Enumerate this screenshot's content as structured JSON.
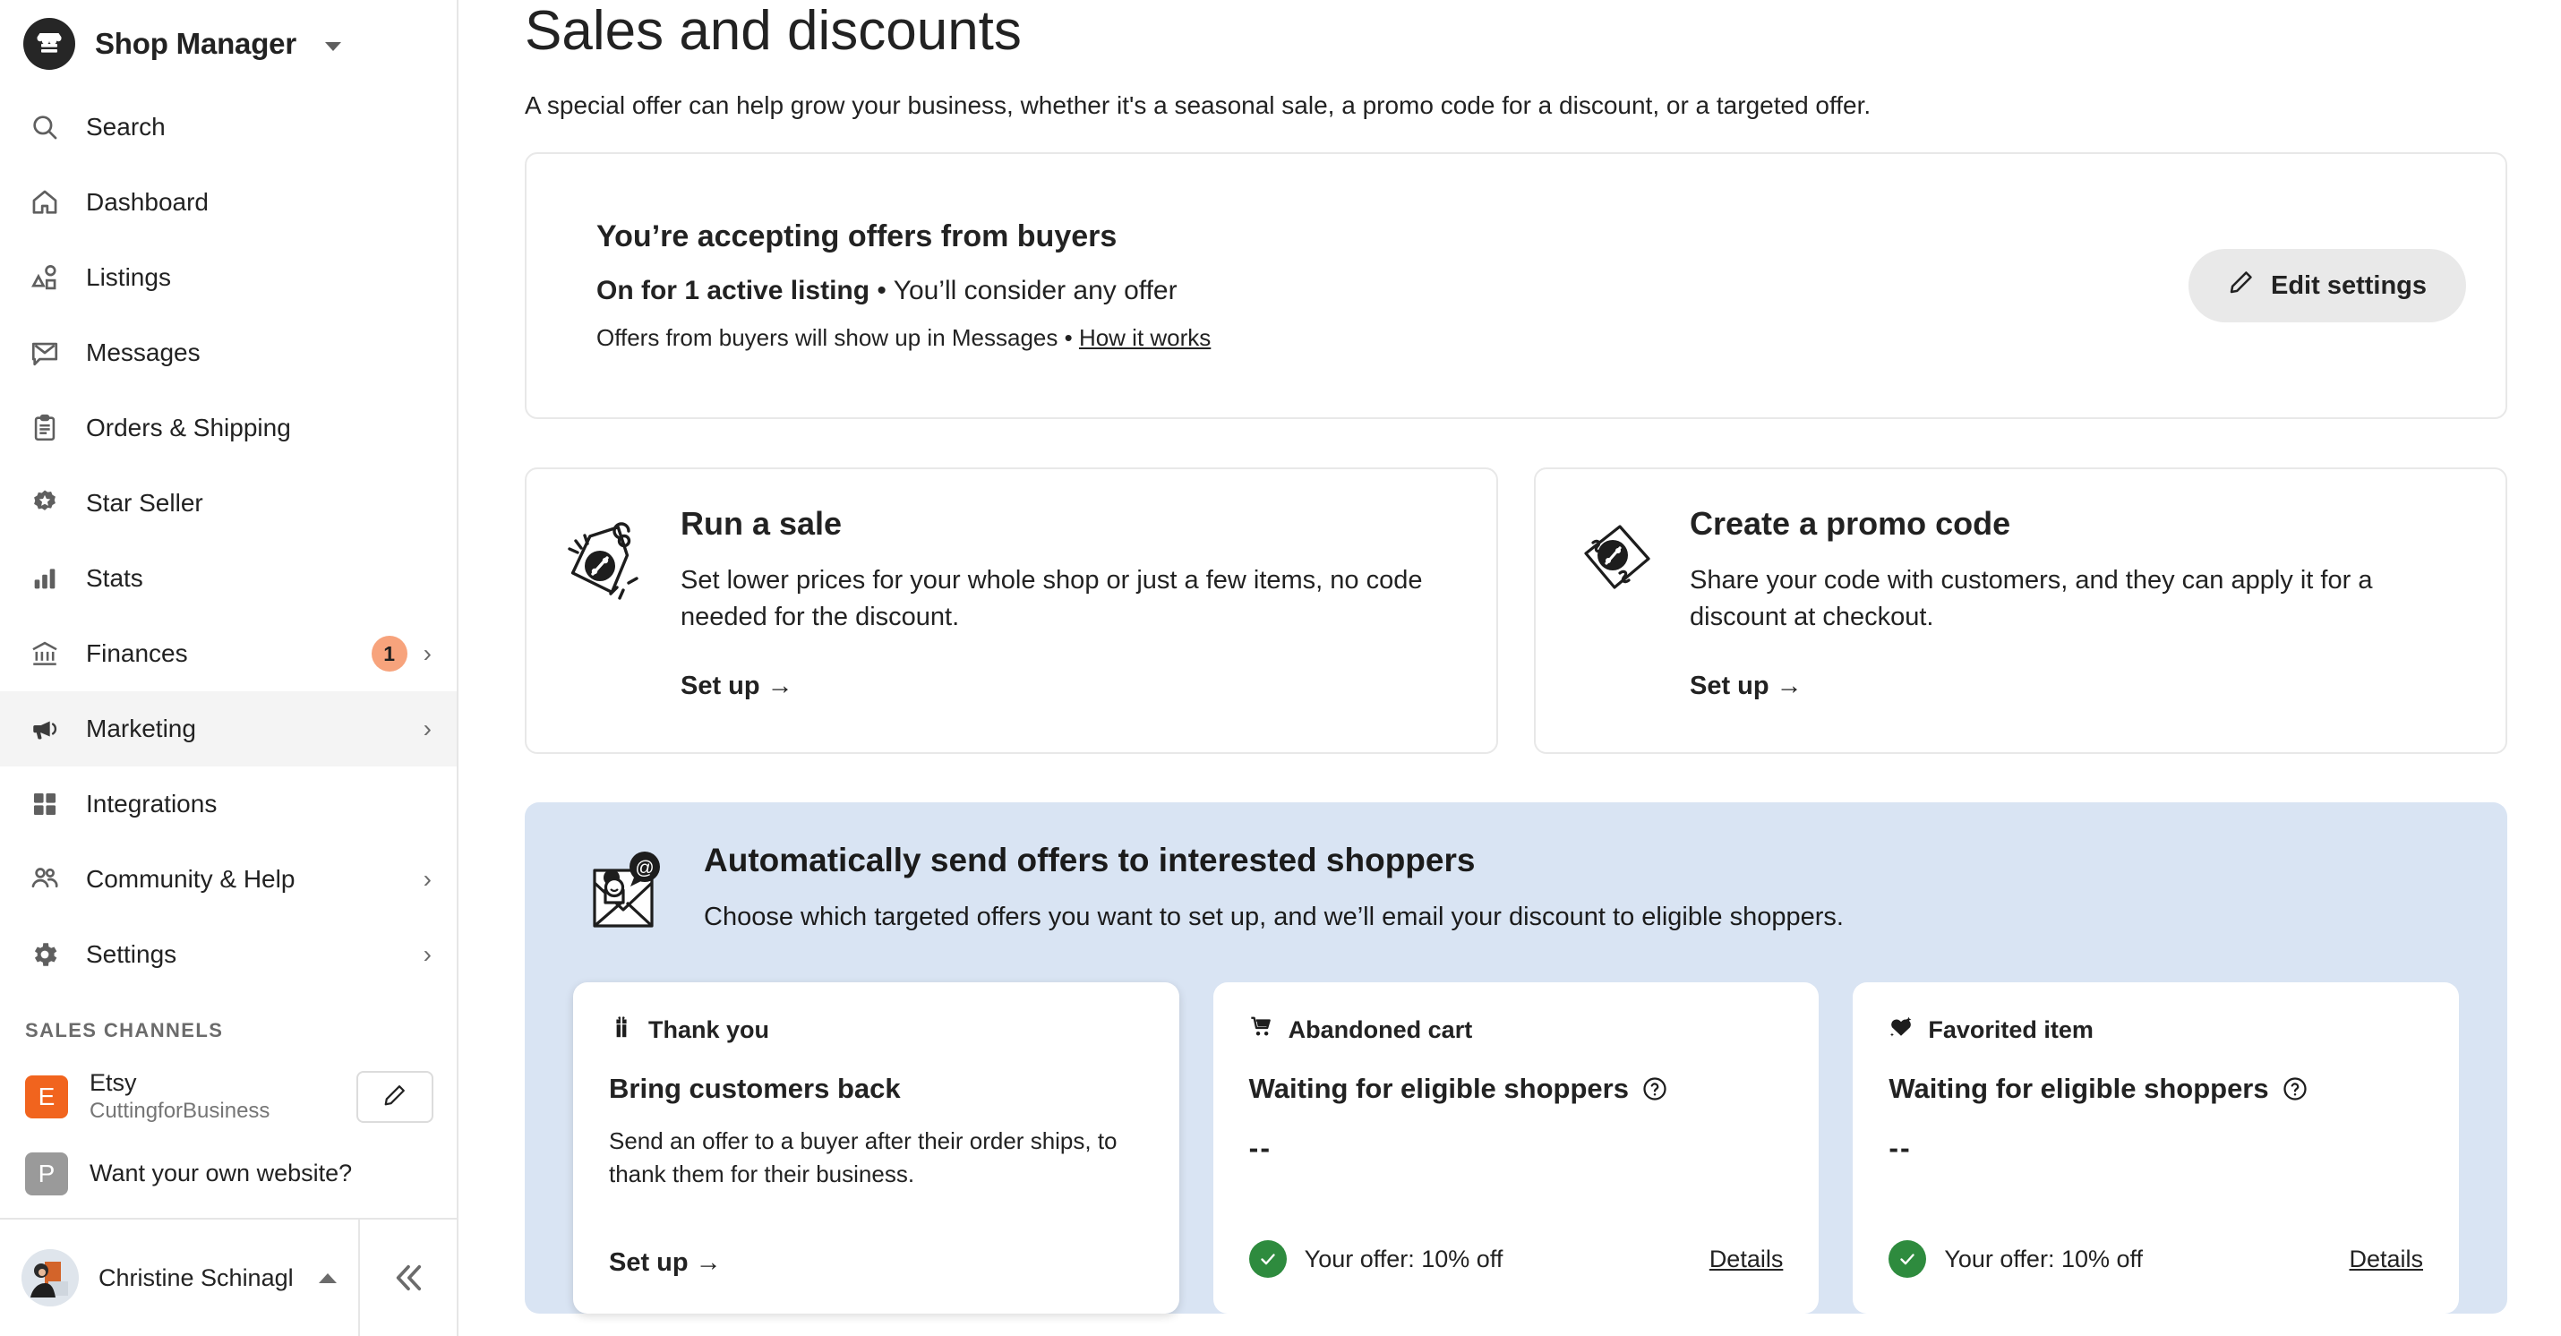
{
  "sidebar": {
    "shop": {
      "title": "Shop Manager",
      "logo_icon": "storefront-icon",
      "caret_icon": "chevron-down-icon"
    },
    "items": [
      {
        "label": "Search",
        "icon": "search-icon",
        "badge": "",
        "chevron": ""
      },
      {
        "label": "Dashboard",
        "icon": "home-icon",
        "badge": "",
        "chevron": ""
      },
      {
        "label": "Listings",
        "icon": "shapes-icon",
        "badge": "",
        "chevron": ""
      },
      {
        "label": "Messages",
        "icon": "envelope-icon",
        "badge": "",
        "chevron": ""
      },
      {
        "label": "Orders & Shipping",
        "icon": "clipboard-icon",
        "badge": "",
        "chevron": ""
      },
      {
        "label": "Star Seller",
        "icon": "star-badge-icon",
        "badge": "",
        "chevron": ""
      },
      {
        "label": "Stats",
        "icon": "bar-chart-icon",
        "badge": "",
        "chevron": ""
      },
      {
        "label": "Finances",
        "icon": "bank-icon",
        "badge": "1",
        "chevron": "›"
      },
      {
        "label": "Marketing",
        "icon": "megaphone-icon",
        "badge": "",
        "chevron": "›"
      },
      {
        "label": "Integrations",
        "icon": "grid-icon",
        "badge": "",
        "chevron": ""
      },
      {
        "label": "Community & Help",
        "icon": "people-icon",
        "badge": "",
        "chevron": "›"
      },
      {
        "label": "Settings",
        "icon": "gear-icon",
        "badge": "",
        "chevron": "›"
      }
    ],
    "active_item": "Marketing",
    "sales_channels_label": "SALES CHANNELS",
    "channels": [
      {
        "initial": "E",
        "name": "Etsy",
        "sub": "CuttingforBusiness",
        "color": "#f1641e",
        "action_icon": "pencil-icon"
      },
      {
        "initial": "P",
        "name": "Want your own website?",
        "sub": "",
        "color": "#9a9a9a",
        "action_icon": ""
      }
    ],
    "footer": {
      "user_name": "Christine Schinagl",
      "caret_icon": "chevron-up-icon",
      "collapse_icon": "chevrons-left-icon",
      "avatar_icon": "avatar"
    }
  },
  "main": {
    "title": "Sales and discounts",
    "subtitle": "A special offer can help grow your business, whether it's a seasonal sale, a promo code for a discount, or a targeted offer.",
    "offers_card": {
      "heading": "You’re accepting offers from buyers",
      "status_strong": "On for 1 active listing",
      "status_rest": " • You’ll consider any offer",
      "note": "Offers from buyers will show up in Messages • ",
      "note_link": "How it works",
      "edit_button": "Edit settings",
      "edit_icon": "pencil-icon"
    },
    "feature_cards": [
      {
        "icon": "price-tag-icon",
        "title": "Run a sale",
        "description": "Set lower prices for your whole shop or just a few items, no code needed for the discount.",
        "cta": "Set up →"
      },
      {
        "icon": "coupon-percent-icon",
        "title": "Create a promo code",
        "description": "Share your code with customers, and they can apply it for a discount at checkout.",
        "cta": "Set up →"
      }
    ],
    "auto_panel": {
      "icon": "email-person-icon",
      "heading": "Automatically send offers to interested shoppers",
      "description": "Choose which targeted offers you want to set up, and we’ll email your discount to eligible shoppers.",
      "background_color": "#d9e4f3",
      "cards": [
        {
          "kicker": "Thank you",
          "kicker_icon": "gift-icon",
          "heading": "Bring customers back",
          "description": "Send an offer to a buyer after their order ships, to thank them for their business.",
          "cta": "Set up →",
          "dash": "",
          "offer_value": "",
          "details": "",
          "has_help": false,
          "elevated": true
        },
        {
          "kicker": "Abandoned cart",
          "kicker_icon": "shopping-cart-icon",
          "heading": "Waiting for eligible shoppers",
          "description": "",
          "cta": "",
          "dash": "--",
          "offer_value": "Your offer: 10% off",
          "details": "Details",
          "has_help": true,
          "elevated": false
        },
        {
          "kicker": "Favorited item",
          "kicker_icon": "heart-sparkle-icon",
          "heading": "Waiting for eligible shoppers",
          "description": "",
          "cta": "",
          "dash": "--",
          "offer_value": "Your offer: 10% off",
          "details": "Details",
          "has_help": true,
          "elevated": false
        }
      ]
    }
  },
  "colors": {
    "accent_blue": "#d9e4f3",
    "etsy_orange": "#f1641e",
    "badge_orange": "#f7a37c",
    "success_green": "#2e8b3e"
  }
}
